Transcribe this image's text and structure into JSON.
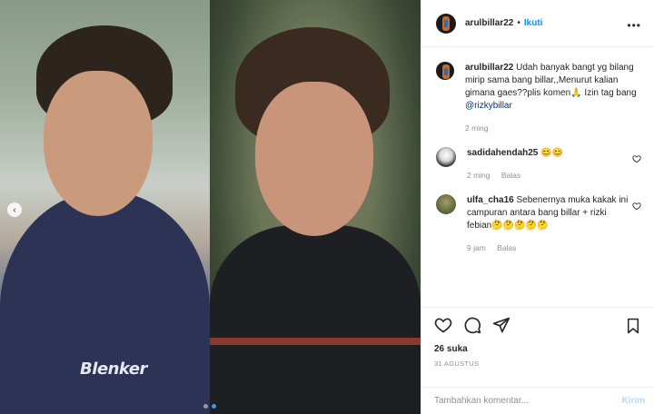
{
  "post": {
    "author": "arulbillar22",
    "separator": "•",
    "follow_label": "Ikuti",
    "more_label": "•••",
    "caption": {
      "username": "arulbillar22",
      "text": "Udah banyak bangt yg bilang mirip sama bang billar,,Menurut kalian gimana gaes??plis komen🙏 Izin tag bang ",
      "mention": "@rizkybillar",
      "time": "2 ming"
    },
    "comments": [
      {
        "username": "sadidahendah25",
        "text": "😊😊",
        "time": "2 ming",
        "reply_label": "Balas"
      },
      {
        "username": "ulfa_cha16",
        "text": "Sebenernya muka kakak ini campuran antara bang billar + rizki febian🤔🤔🤔🤔🤔",
        "time": "9 jam",
        "reply_label": "Balas"
      }
    ],
    "likes": "26 suka",
    "date": "31 AGUSTUS",
    "add_comment_placeholder": "Tambahkan komentar...",
    "post_button": "Kirim"
  },
  "media": {
    "left_logo_text": "Blenker",
    "nav_prev": "‹"
  },
  "icons": {
    "heart": "heart-icon",
    "comment": "comment-icon",
    "share": "share-icon",
    "bookmark": "bookmark-icon",
    "small_heart": "small-heart-icon"
  },
  "colors": {
    "accent": "#0095f6",
    "post_disabled": "#b3dbff",
    "muted": "#8e8e8e"
  }
}
